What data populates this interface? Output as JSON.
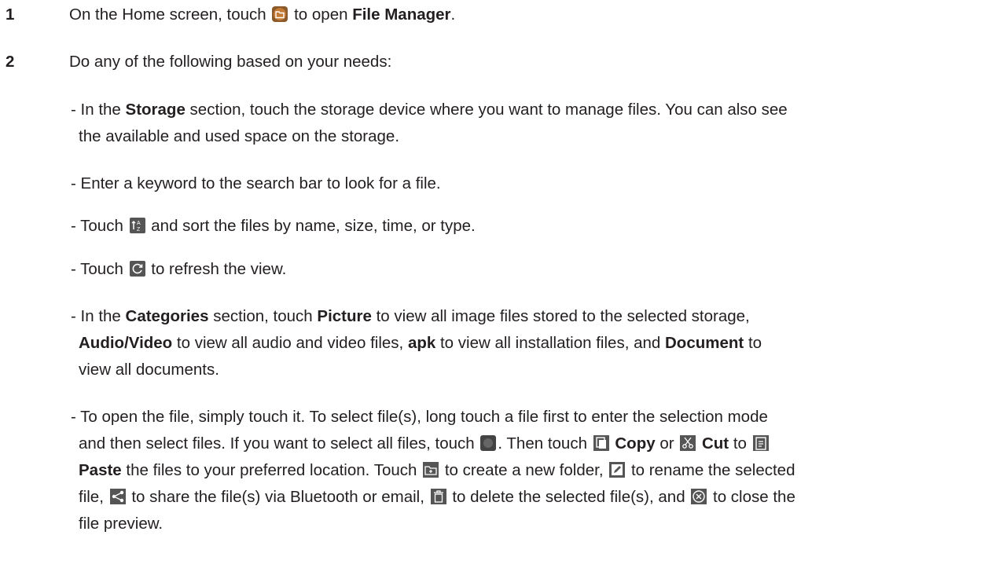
{
  "step1": {
    "number": "1",
    "pre": "On the Home screen, touch",
    "mid": "to open",
    "bold": "File Manager",
    "post": "."
  },
  "step2": {
    "number": "2",
    "intro": "Do any of the following based on your needs:",
    "storage": {
      "pre": "- In the",
      "bold": "Storage",
      "post": "section, touch the storage device where you want to manage files. You can also see",
      "line2": "the available and used space on the storage."
    },
    "search": "- Enter a keyword to the search bar to look for a file.",
    "sort": {
      "pre": "- Touch",
      "post": "and sort the files by name, size, time, or type."
    },
    "refresh": {
      "pre": "- Touch",
      "post": "to refresh the view."
    },
    "categories": {
      "pre": "- In the",
      "b1": "Categories",
      "t1": "section, touch",
      "b2": "Picture",
      "t2": "to view all image files stored to the selected storage,",
      "b3": "Audio/Video",
      "t3": "to view all audio and video files,",
      "b4": "apk",
      "t4": "to view all installation files, and",
      "b5": "Document",
      "t5": "to",
      "line3": "view all documents."
    },
    "files": {
      "line1": "- To open the file, simply touch it. To select file(s), long touch a file first to enter the selection mode",
      "l2a": "and then select files. If you want to select all files, touch",
      "l2b": ". Then touch",
      "copy": "Copy",
      "or": "or",
      "cut": "Cut",
      "to": "to",
      "paste": "Paste",
      "l3a": "the files to your preferred location. Touch",
      "l3b": "to create a new folder,",
      "l3c": "to rename the selected",
      "l4a": "file,",
      "l4b": "to share the file(s) via Bluetooth or email,",
      "l4c": "to delete the selected file(s), and",
      "l4d": "to close the",
      "line5": "file preview."
    }
  },
  "colors": {
    "text": "#231f20",
    "icon_bg": "#555555",
    "file_manager_icon": "#b5651d"
  },
  "icons": [
    "file-manager-icon",
    "sort-icon",
    "refresh-icon",
    "select-all-icon",
    "copy-icon",
    "cut-icon",
    "paste-icon",
    "new-folder-icon",
    "rename-icon",
    "share-icon",
    "delete-icon",
    "close-preview-icon"
  ]
}
